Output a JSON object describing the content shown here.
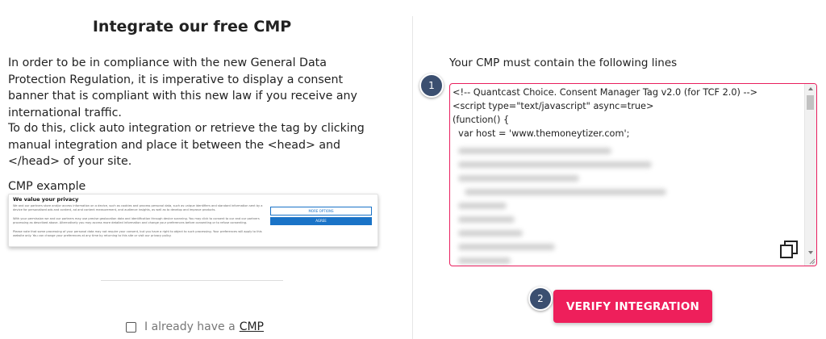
{
  "left": {
    "title": "Integrate our free CMP",
    "paragraph1": "In order to be in compliance with the new General Data Protection Regulation, it is imperative to display a consent banner that is compliant with this new law if you receive any international traffic.",
    "paragraph2": "To do this, click auto integration or retrieve the tag by clicking manual integration and place it between the <head> and </head> of your site.",
    "example_label": "CMP example",
    "example": {
      "title": "We value your privacy",
      "text1": "We and our partners store and/or access information on a device, such as cookies and process personal data, such as unique identifiers and standard information sent by a device for personalised ads and content, ad and content measurement, and audience insights, as well as to develop and improve products.",
      "text2": "With your permission we and our partners may use precise geolocation data and identification through device scanning. You may click to consent to our and our partners processing as described above. Alternatively you may access more detailed information and change your preferences before consenting or to refuse consenting.",
      "text3": "Please note that some processing of your personal data may not require your consent, but you have a right to object to such processing. Your preferences will apply to this website only. You can change your preferences at any time by returning to this site or visit our privacy policy.",
      "more_options": "MORE OPTIONS",
      "agree": "AGREE"
    },
    "checkbox_label": "I already have a",
    "checkbox_link": "CMP"
  },
  "right": {
    "instruction": "Your CMP must contain the following lines",
    "step1": "1",
    "step2": "2",
    "code_lines": [
      "<!-- Quantcast Choice. Consent Manager Tag v2.0 (for TCF 2.0) -->",
      "<script type=\"text/javascript\" async=true>",
      "(function() {",
      "  var host = 'www.themoneytizer.com';"
    ],
    "verify_button": "VERIFY INTEGRATION",
    "copy_icon": "copy-icon"
  },
  "colors": {
    "accent": "#ee1f5b",
    "code_border": "#e91e5e",
    "step_badge": "#3b4f70",
    "example_button": "#1a73c7"
  }
}
